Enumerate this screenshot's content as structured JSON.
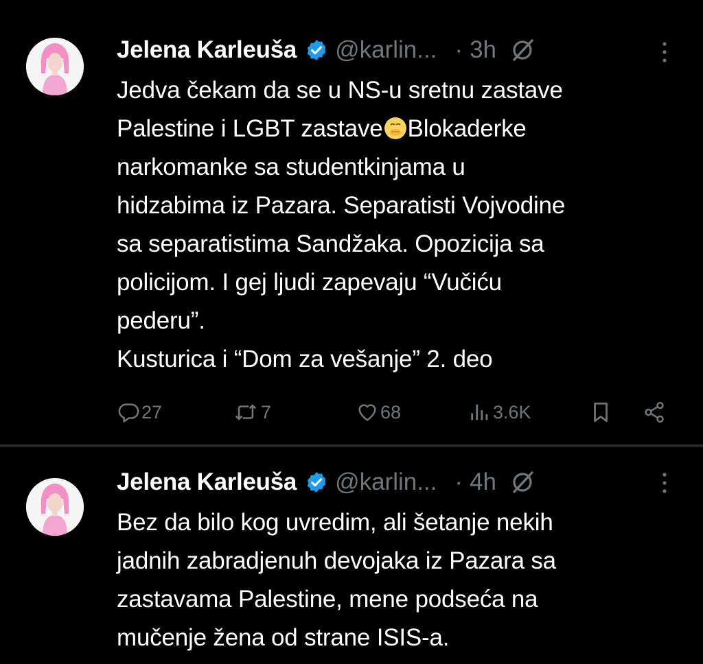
{
  "tweets": [
    {
      "author_name": "Jelena Karleuša",
      "handle": "@karlin...",
      "separator": "·",
      "time": "3h",
      "text_part1": "Jedva čekam da se u NS-u sretnu zastave\nPalestine i LGBT zastave",
      "emoji": "face-with-hand-over-mouth",
      "text_part2": "Blokaderke\nnarkomanke sa studentkinjama u\nhidzabima iz Pazara. Separatisti Vojvodine\nsa separatistima Sandžaka. Opozicija sa\npolicijom. I gej ljudi zapevaju “Vučiću\npederu”.\nKusturica i “Dom za vešanje” 2. deo",
      "stats": {
        "replies": "27",
        "reposts": "7",
        "likes": "68",
        "views": "3.6K"
      }
    },
    {
      "author_name": "Jelena Karleuša",
      "handle": "@karlin...",
      "separator": "·",
      "time": "4h",
      "text": "Bez da bilo kog uvredim, ali šetanje nekih\njadnih zabradjenuh devojaka iz Pazara sa\nzastavama Palestine, mene podseća na\nmučenje žena od strane ISIS-a."
    }
  ],
  "icons": {
    "verified": "verified-badge-icon",
    "grok": "grok-icon",
    "more": "more-vertical-icon",
    "reply": "reply-icon",
    "repost": "repost-icon",
    "like": "heart-icon",
    "views": "views-icon",
    "bookmark": "bookmark-icon",
    "share": "share-icon"
  },
  "colors": {
    "background": "#000000",
    "text": "#ffffff",
    "secondary": "#71767b",
    "verified": "#1d9bf0",
    "divider": "#2f3336",
    "avatar_pink": "#f4a6d3"
  }
}
